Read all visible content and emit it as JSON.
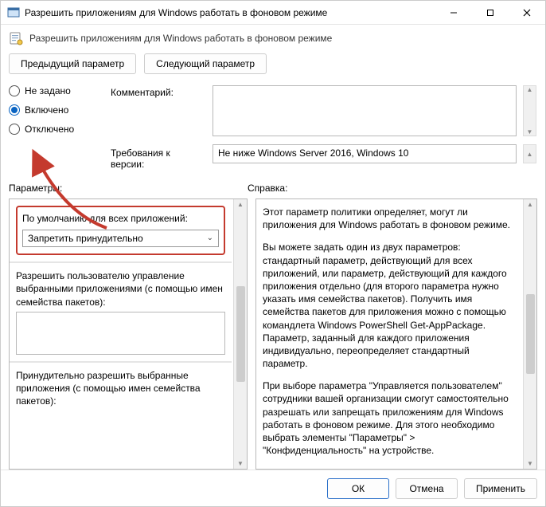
{
  "window": {
    "title": "Разрешить приложениям для Windows работать в фоновом режиме"
  },
  "header": {
    "title": "Разрешить приложениям для Windows работать в фоновом режиме"
  },
  "nav": {
    "prev": "Предыдущий параметр",
    "next": "Следующий параметр"
  },
  "state": {
    "options": {
      "not_configured": "Не задано",
      "enabled": "Включено",
      "disabled": "Отключено"
    },
    "selected": "enabled"
  },
  "labels": {
    "comment": "Комментарий:",
    "requirements": "Требования к версии:",
    "options_section": "Параметры:",
    "help_section": "Справка:"
  },
  "requirements": {
    "text": "Не ниже Windows Server 2016, Windows 10"
  },
  "options": {
    "default_label": "По умолчанию для всех приложений:",
    "default_value": "Запретить принудительно",
    "user_control_label": "Разрешить пользователю управление выбранными приложениями (с помощью имен семейства пакетов):",
    "force_allow_label": "Принудительно разрешить выбранные приложения (с помощью имен семейства пакетов):"
  },
  "help": {
    "p1": "Этот параметр политики определяет, могут ли приложения для Windows работать в фоновом режиме.",
    "p2": "Вы можете задать один из двух параметров: стандартный параметр, действующий для всех приложений, или параметр, действующий для каждого приложения отдельно (для второго параметра нужно указать имя семейства пакетов). Получить имя семейства пакетов для приложения можно с помощью командлета Windows PowerShell Get-AppPackage. Параметр, заданный для каждого приложения индивидуально, переопределяет стандартный параметр.",
    "p3": "При выборе параметра \"Управляется пользователем\" сотрудники вашей организации смогут самостоятельно разрешать или запрещать приложениям для Windows работать в фоновом режиме. Для этого необходимо выбрать элементы \"Параметры\" > \"Конфиденциальность\" на устройстве."
  },
  "buttons": {
    "ok": "ОК",
    "cancel": "Отмена",
    "apply": "Применить"
  }
}
